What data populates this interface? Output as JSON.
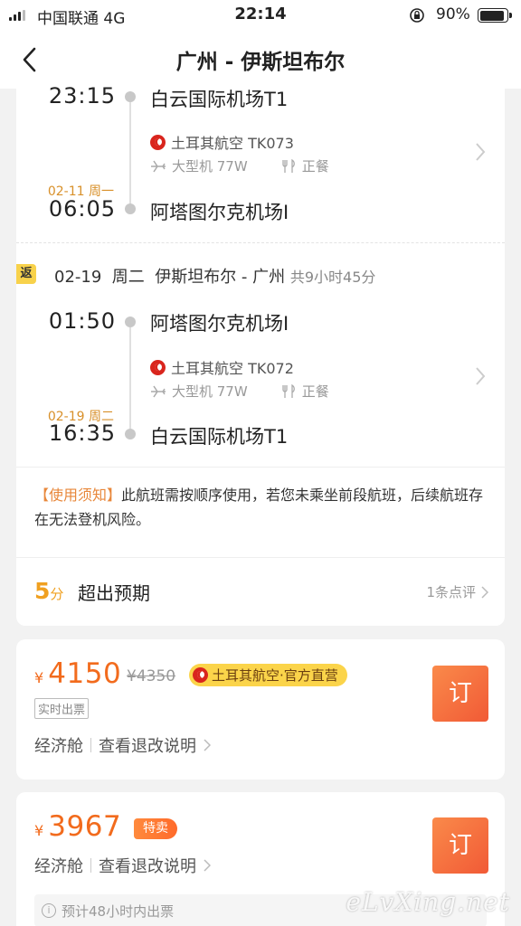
{
  "status_bar": {
    "carrier": "中国联通  4G",
    "time": "22:14",
    "battery": "90%",
    "battery_level": 0.9
  },
  "nav": {
    "title": "广州 - 伊斯坦布尔",
    "back_icon": "chevron-left-icon"
  },
  "outbound": {
    "depart_time": "23:15",
    "depart_airport": "白云国际机场T1",
    "airline": "土耳其航空 TK073",
    "aircraft": "大型机 77W",
    "meal": "正餐",
    "arrive_date": "02-11 周一",
    "arrive_time": "06:05",
    "arrive_airport": "阿塔图尔克机场I"
  },
  "return": {
    "badge": "返",
    "summary": "02-19  周二  伊斯坦布尔 - 广州",
    "duration": "共9小时45分",
    "depart_time": "01:50",
    "depart_airport": "阿塔图尔克机场I",
    "airline": "土耳其航空 TK072",
    "aircraft": "大型机 77W",
    "meal": "正餐",
    "arrive_date": "02-19 周二",
    "arrive_time": "16:35",
    "arrive_airport": "白云国际机场T1"
  },
  "notice": {
    "tag": "【使用须知】",
    "text": "此航班需按顺序使用，若您未乘坐前段航班，后续航班存在无法登机风险。"
  },
  "review": {
    "score": "5",
    "unit": "分",
    "text": "超出预期",
    "link": "1条点评"
  },
  "offers": [
    {
      "currency": "¥",
      "price": "4150",
      "old_price": "¥4350",
      "badge": "土耳其航空·官方直营",
      "tag": "实时出票",
      "cabin": "经济舱",
      "policy": "查看退改说明",
      "book": "订"
    },
    {
      "currency": "¥",
      "price": "3967",
      "badge": "特卖",
      "cabin": "经济舱",
      "policy": "查看退改说明",
      "book": "订",
      "note": "预计48小时内出票"
    }
  ],
  "watermark": "eLvXing.net",
  "colors": {
    "accent": "#f26b1d",
    "gold": "#f0a020",
    "badge_yellow": "#fbd44a",
    "airline_red": "#d9251d"
  }
}
